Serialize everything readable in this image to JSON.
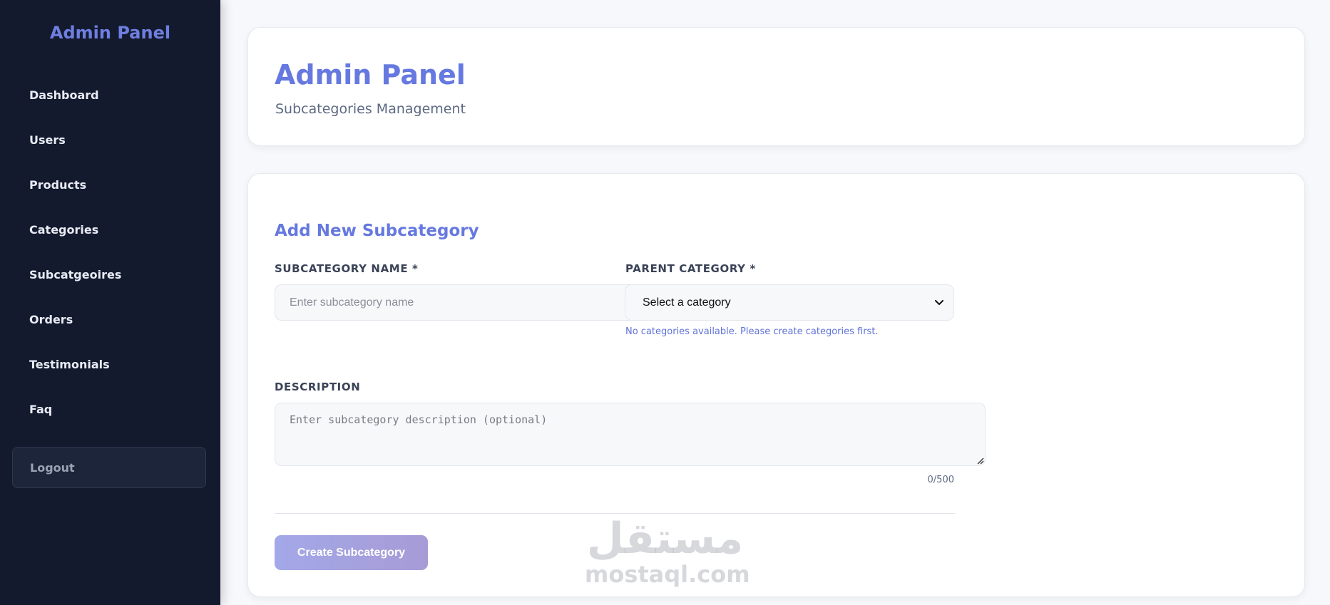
{
  "sidebar": {
    "title": "Admin Panel",
    "items": [
      {
        "label": "Dashboard"
      },
      {
        "label": "Users"
      },
      {
        "label": "Products"
      },
      {
        "label": "Categories"
      },
      {
        "label": "Subcatgeoires"
      },
      {
        "label": "Orders"
      },
      {
        "label": "Testimonials"
      },
      {
        "label": "Faq"
      }
    ],
    "logout_label": "Logout"
  },
  "header": {
    "title": "Admin Panel",
    "subtitle": "Subcategories Management"
  },
  "form": {
    "heading": "Add New Subcategory",
    "name_label": "SUBCATEGORY NAME *",
    "name_placeholder": "Enter subcategory name",
    "name_value": "",
    "parent_label": "PARENT CATEGORY *",
    "parent_selected": "Select a category",
    "parent_hint": "No categories available. Please create categories first.",
    "description_label": "DESCRIPTION",
    "description_placeholder": "Enter subcategory description (optional)",
    "description_value": "",
    "char_count": "0/500",
    "submit_label": "Create Subcategory"
  },
  "watermark": {
    "arabic": "مستقل",
    "latin": "mostaql.com"
  },
  "colors": {
    "sidebar_bg": "#131a2e",
    "accent": "#6679e0",
    "button_gradient_start": "#a3a8e8",
    "button_gradient_end": "#a79bd6"
  }
}
